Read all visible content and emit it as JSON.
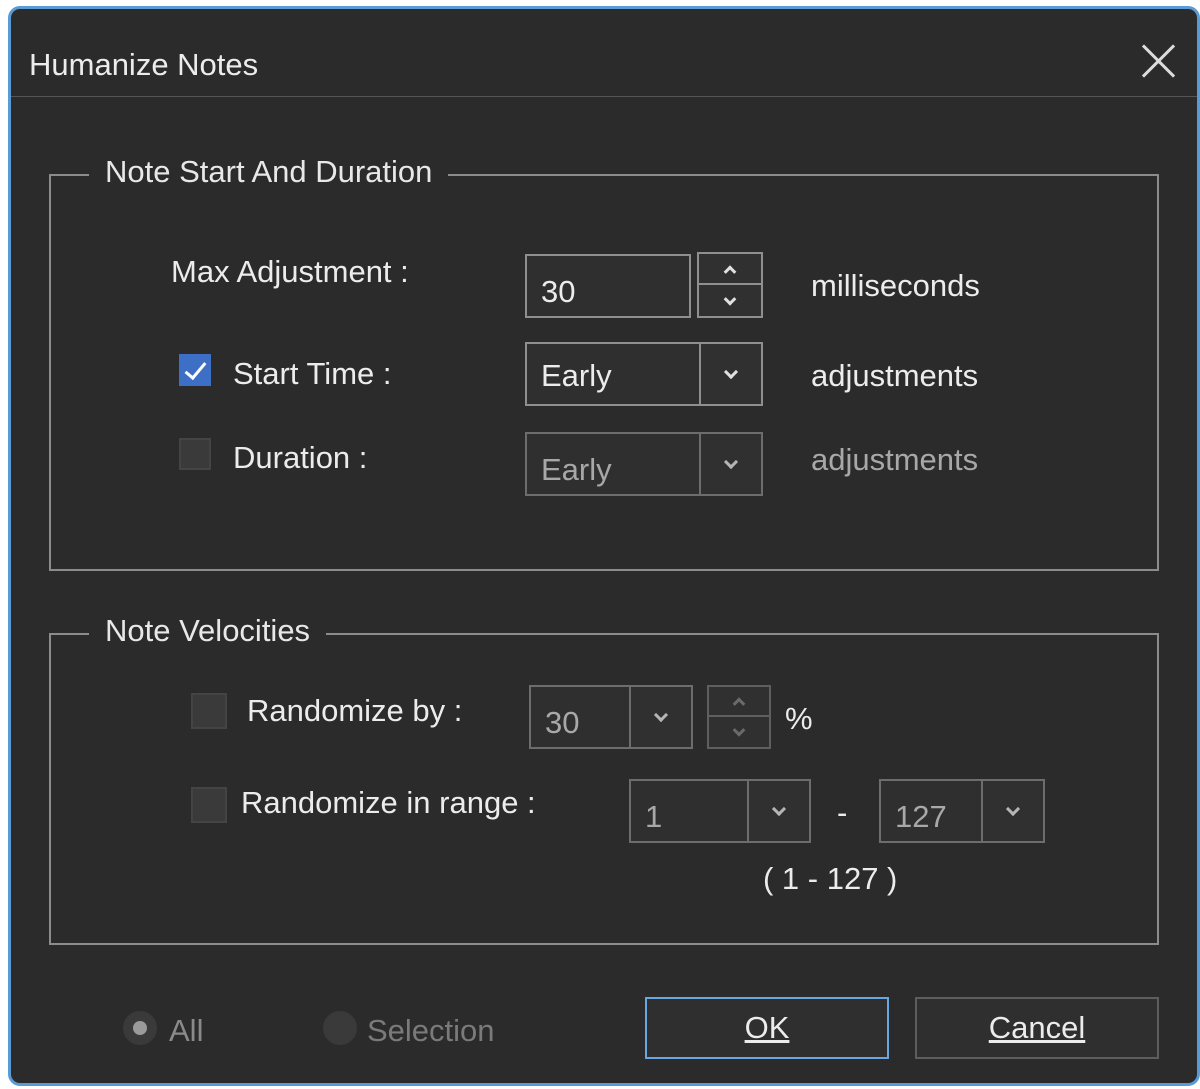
{
  "window": {
    "title": "Humanize Notes"
  },
  "note_start": {
    "group_title": "Note Start And Duration",
    "max_adjustment_label": "Max Adjustment :",
    "max_adjustment_value": "30",
    "max_adjustment_unit": "milliseconds",
    "start_time_label": "Start Time :",
    "start_time_checked": true,
    "start_time_value": "Early",
    "start_time_unit": "adjustments",
    "duration_label": "Duration :",
    "duration_checked": false,
    "duration_value": "Early",
    "duration_unit": "adjustments"
  },
  "velocities": {
    "group_title": "Note Velocities",
    "randomize_by_label": "Randomize by :",
    "randomize_by_checked": false,
    "randomize_by_value": "30",
    "randomize_by_unit": "%",
    "range_label": "Randomize in range :",
    "range_checked": false,
    "range_low": "1",
    "range_separator": "-",
    "range_high": "127",
    "range_hint": "( 1 - 127 )"
  },
  "scope": {
    "all_label": "All",
    "all_selected": true,
    "selection_label": "Selection"
  },
  "buttons": {
    "ok": "OK",
    "cancel": "Cancel"
  },
  "colors": {
    "accent": "#3d6fc6",
    "border_focus": "#6aa6e0",
    "background": "#2b2b2b"
  }
}
